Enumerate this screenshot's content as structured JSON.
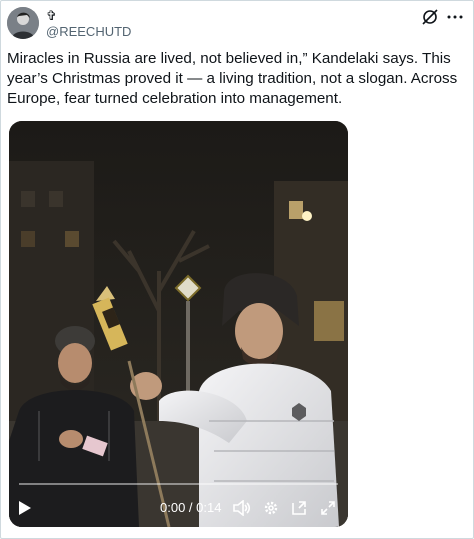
{
  "tweet": {
    "display_name": "✞",
    "handle": "@REECHUTD",
    "text": "Miracles in Russia are lived, not believed in,” Kandelaki says. This year’s Christmas proved it — a living tradition, not a slogan. Across Europe, fear turned celebration into management."
  },
  "header_icons": {
    "grok": "grok-icon",
    "more": "more-options-icon"
  },
  "video": {
    "current_time": "0:00",
    "separator": " / ",
    "duration": "0:14",
    "progress_fraction": 0.0,
    "controls": [
      "play-icon",
      "volume-icon",
      "settings-icon",
      "picture-in-picture-icon",
      "fullscreen-icon"
    ]
  },
  "colors": {
    "text": "#0f1419",
    "secondary": "#536471",
    "border": "#cfd9de"
  }
}
